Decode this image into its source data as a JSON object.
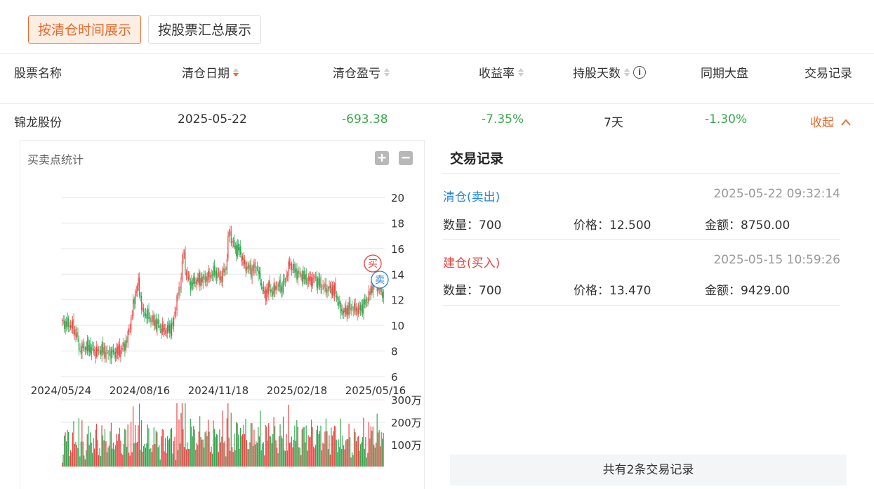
{
  "tabs": [
    {
      "label": "按清仓时间展示",
      "active": true
    },
    {
      "label": "按股票汇总展示",
      "active": false
    }
  ],
  "table": {
    "headers": {
      "name": "股票名称",
      "date": "清仓日期",
      "pnl": "清仓盈亏",
      "rate": "收益率",
      "days": "持股天数",
      "market": "同期大盘",
      "records": "交易记录"
    },
    "row": {
      "name": "锦龙股份",
      "date": "2025-05-22",
      "pnl": "-693.38",
      "rate": "-7.35%",
      "days": "7天",
      "market": "-1.30%",
      "action": "收起"
    }
  },
  "chart_panel": {
    "title": "买卖点统计",
    "zoom_in": "+",
    "zoom_out": "−"
  },
  "chart_data": {
    "type": "candlestick",
    "price_axis": {
      "ticks": [
        "20",
        "18",
        "16",
        "14",
        "12",
        "10",
        "8",
        "6"
      ],
      "range": [
        6,
        20
      ]
    },
    "date_ticks": [
      "2024/05/24",
      "2024/08/16",
      "2024/11/18",
      "2025/02/18",
      "2025/05/16"
    ],
    "volume_axis": {
      "ticks": [
        "300万",
        "200万",
        "100万"
      ]
    },
    "markers": [
      {
        "label": "买",
        "date": "2025-05-15",
        "price": 13.47,
        "color": "#e8423f"
      },
      {
        "label": "卖",
        "date": "2025-05-22",
        "price": 12.5,
        "color": "#2a86d6"
      }
    ],
    "close_keypoints": [
      [
        0,
        10.2
      ],
      [
        5,
        10.1
      ],
      [
        10,
        9.9
      ],
      [
        14,
        9.2
      ],
      [
        17,
        8.0
      ],
      [
        20,
        8.3
      ],
      [
        26,
        8.3
      ],
      [
        32,
        7.9
      ],
      [
        38,
        8.1
      ],
      [
        44,
        7.8
      ],
      [
        52,
        7.9
      ],
      [
        58,
        8.2
      ],
      [
        62,
        8.8
      ],
      [
        66,
        10.5
      ],
      [
        70,
        12.5
      ],
      [
        73,
        13.3
      ],
      [
        77,
        11.0
      ],
      [
        82,
        10.8
      ],
      [
        86,
        10.4
      ],
      [
        90,
        10.2
      ],
      [
        94,
        9.8
      ],
      [
        98,
        9.6
      ],
      [
        102,
        9.7
      ],
      [
        106,
        10.0
      ],
      [
        110,
        12.0
      ],
      [
        113,
        13.0
      ],
      [
        116,
        15.8
      ],
      [
        119,
        14.0
      ],
      [
        123,
        13.2
      ],
      [
        128,
        13.5
      ],
      [
        134,
        13.6
      ],
      [
        140,
        13.8
      ],
      [
        146,
        14.2
      ],
      [
        152,
        13.7
      ],
      [
        157,
        14.5
      ],
      [
        160,
        17.5
      ],
      [
        163,
        16.5
      ],
      [
        166,
        16.0
      ],
      [
        170,
        15.9
      ],
      [
        174,
        14.8
      ],
      [
        178,
        14.5
      ],
      [
        182,
        14.3
      ],
      [
        186,
        14.6
      ],
      [
        190,
        13.5
      ],
      [
        194,
        12.3
      ],
      [
        198,
        13.0
      ],
      [
        202,
        12.6
      ],
      [
        206,
        13.2
      ],
      [
        210,
        12.9
      ],
      [
        214,
        13.6
      ],
      [
        218,
        14.8
      ],
      [
        222,
        14.4
      ],
      [
        226,
        14.0
      ],
      [
        230,
        13.9
      ],
      [
        234,
        13.6
      ],
      [
        238,
        13.5
      ],
      [
        242,
        13.7
      ],
      [
        246,
        13.3
      ],
      [
        250,
        13.0
      ],
      [
        254,
        12.8
      ],
      [
        258,
        12.9
      ],
      [
        262,
        12.6
      ],
      [
        266,
        11.4
      ],
      [
        270,
        11.0
      ],
      [
        274,
        11.3
      ],
      [
        278,
        11.4
      ],
      [
        282,
        11.2
      ],
      [
        286,
        11.3
      ],
      [
        290,
        11.7
      ],
      [
        294,
        12.3
      ],
      [
        298,
        13.2
      ],
      [
        301,
        13.4
      ],
      [
        304,
        12.9
      ],
      [
        308,
        12.4
      ]
    ]
  },
  "records": {
    "title": "交易记录",
    "items": [
      {
        "type": "清仓(卖出)",
        "time": "2025-05-22 09:32:14",
        "qty": "数量：700",
        "price": "价格：12.500",
        "amount": "金额：8750.00",
        "color": "#2a86d6"
      },
      {
        "type": "建仓(买入)",
        "time": "2025-05-15 10:59:26",
        "qty": "数量：700",
        "price": "价格：13.470",
        "amount": "金额：9429.00",
        "color": "#e8423f"
      }
    ],
    "footer": "共有2条交易记录"
  }
}
